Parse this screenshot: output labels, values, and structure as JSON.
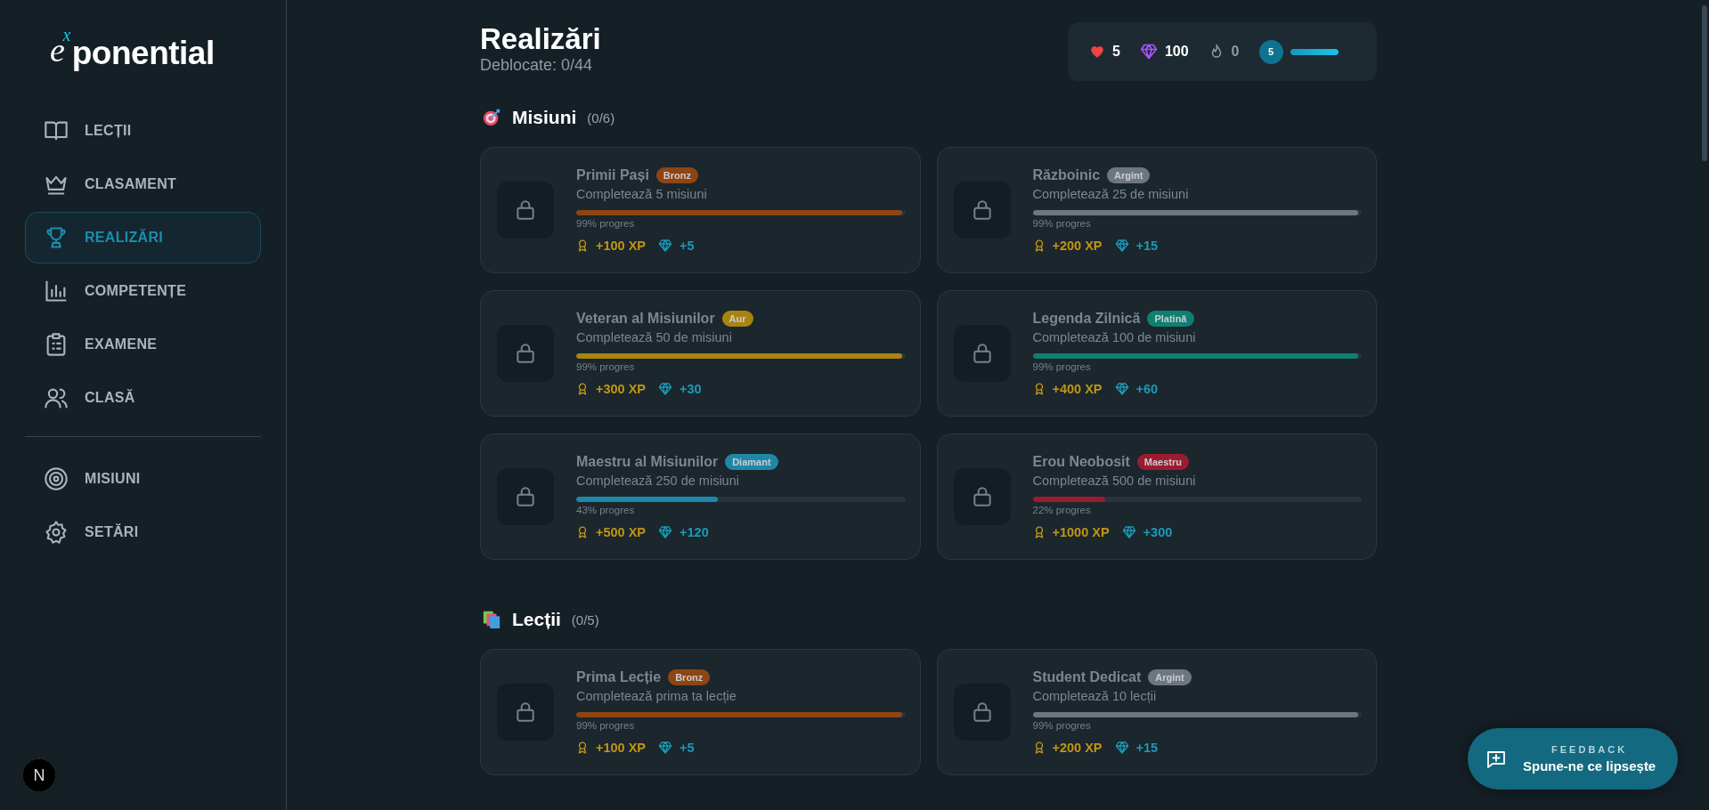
{
  "sidebar": {
    "logo": {
      "base": "e",
      "exponent": "x",
      "rest": "ponential"
    },
    "items": [
      {
        "label": "LECȚII",
        "selected": false
      },
      {
        "label": "CLASAMENT",
        "selected": false
      },
      {
        "label": "REALIZĂRI",
        "selected": true
      },
      {
        "label": "COMPETENȚE",
        "selected": false
      },
      {
        "label": "EXAMENE",
        "selected": false
      },
      {
        "label": "CLASĂ",
        "selected": false
      }
    ],
    "footer_items": [
      {
        "label": "MISIUNI",
        "selected": false
      },
      {
        "label": "SETĂRI",
        "selected": false
      }
    ],
    "dev_badge": "N"
  },
  "header": {
    "title": "Realizări",
    "subtitle": "Deblocate: 0/44",
    "stats": {
      "hearts": "5",
      "gems": "100",
      "streak": "0",
      "level_number": "5",
      "level": 1
    }
  },
  "sections": [
    {
      "title": "Misiuni",
      "count": "(0/6)",
      "cards": [
        {
          "title": "Primii Pași",
          "tier": "Bronz",
          "color": "#8f4513",
          "description": "Completează 5 misiuni",
          "level": 0.99,
          "progress": "99% progres",
          "xp": "+100 XP",
          "gems": "+5",
          "locked": true
        },
        {
          "title": "Războinic",
          "tier": "Argint",
          "color": "#6e7780",
          "description": "Completează 25 de misiuni",
          "level": 0.99,
          "progress": "99% progres",
          "xp": "+200 XP",
          "gems": "+15",
          "locked": true
        },
        {
          "title": "Veteran al Misiunilor",
          "tier": "Aur",
          "color": "#a8840f",
          "description": "Completează 50 de misiuni",
          "level": 0.99,
          "progress": "99% progres",
          "xp": "+300 XP",
          "gems": "+30",
          "locked": true
        },
        {
          "title": "Legenda Zilnică",
          "tier": "Platină",
          "color": "#0f7f73",
          "description": "Completează 100 de misiuni",
          "level": 0.99,
          "progress": "99% progres",
          "xp": "+400 XP",
          "gems": "+60",
          "locked": true
        },
        {
          "title": "Maestru al Misiunilor",
          "tier": "Diamant",
          "color": "#1f88a8",
          "description": "Completează 250 de misiuni",
          "level": 0.43,
          "progress": "43% progres",
          "xp": "+500 XP",
          "gems": "+120",
          "locked": true
        },
        {
          "title": "Erou Neobosit",
          "tier": "Maestru",
          "color": "#9b1b30",
          "description": "Completează 500 de misiuni",
          "level": 0.22,
          "progress": "22% progres",
          "xp": "+1000 XP",
          "gems": "+300",
          "locked": true
        }
      ]
    },
    {
      "title": "Lecții",
      "count": "(0/5)",
      "cards": [
        {
          "title": "Prima Lecție",
          "tier": "Bronz",
          "color": "#8f4513",
          "description": "Completează prima ta lecție",
          "level": 0.99,
          "progress": "99% progres",
          "xp": "+100 XP",
          "gems": "+5",
          "locked": true
        },
        {
          "title": "Student Dedicat",
          "tier": "Argint",
          "color": "#6e7780",
          "description": "Completează 10 lecții",
          "level": 0.99,
          "progress": "99% progres",
          "xp": "+200 XP",
          "gems": "+15",
          "locked": true
        }
      ]
    }
  ],
  "feedback": {
    "label": "FEEDBACK",
    "text": "Spune-ne ce lipsește"
  }
}
